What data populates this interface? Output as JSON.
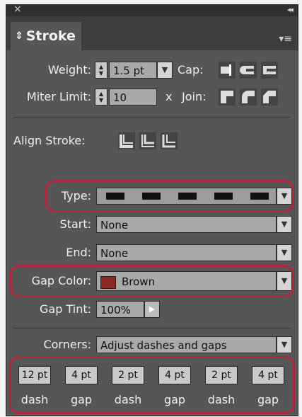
{
  "panel": {
    "title": "Stroke",
    "colors": {
      "highlight": "#b0283a",
      "gap_color": "#8b2a22",
      "panel_bg": "#565656"
    }
  },
  "weight": {
    "label": "Weight:",
    "value": "1.5 pt"
  },
  "cap": {
    "label": "Cap:"
  },
  "miter": {
    "label": "Miter Limit:",
    "value": "10",
    "unit": "x"
  },
  "join": {
    "label": "Join:"
  },
  "align": {
    "label": "Align Stroke:"
  },
  "type": {
    "label": "Type:"
  },
  "start": {
    "label": "Start:",
    "value": "None"
  },
  "end": {
    "label": "End:",
    "value": "None"
  },
  "gap_color": {
    "label": "Gap Color:",
    "value": "Brown"
  },
  "gap_tint": {
    "label": "Gap Tint:",
    "value": "100%"
  },
  "corners": {
    "label": "Corners:",
    "value": "Adjust dashes and gaps"
  },
  "dashes": [
    {
      "value": "12 pt",
      "label": "dash"
    },
    {
      "value": "4 pt",
      "label": "gap"
    },
    {
      "value": "2 pt",
      "label": "dash"
    },
    {
      "value": "4 pt",
      "label": "gap"
    },
    {
      "value": "2 pt",
      "label": "dash"
    },
    {
      "value": "4 pt",
      "label": "gap"
    }
  ]
}
